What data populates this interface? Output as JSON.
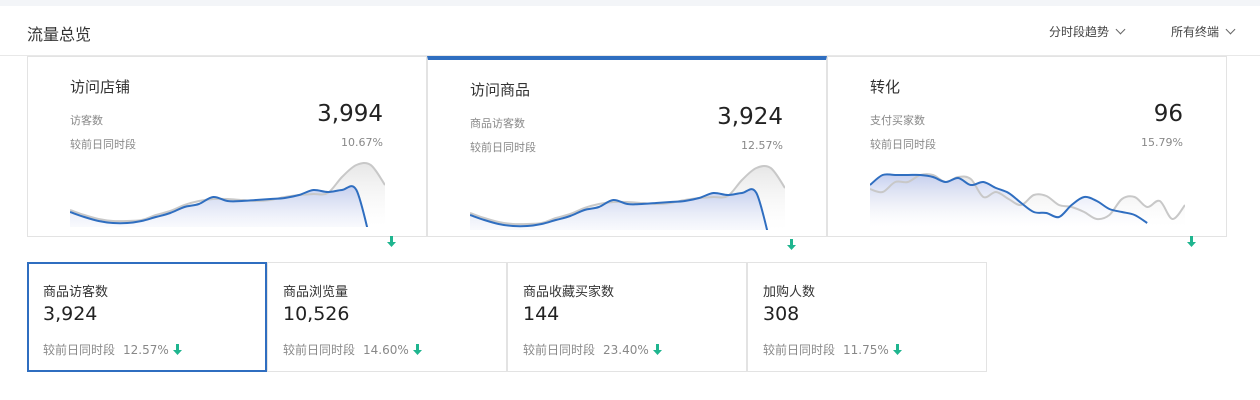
{
  "header": {
    "title": "流量总览",
    "time_dropdown": "分时段趋势",
    "terminal_dropdown": "所有终端"
  },
  "colors": {
    "accent": "#2f6ec0",
    "down_arrow": "#1fb58f",
    "today_line": "#2f6ec0",
    "yesterday_line": "#c8c8c8"
  },
  "big_cards": [
    {
      "title": "访问店铺",
      "metric": "访客数",
      "compare_label": "较前日同时段",
      "value": "3,994",
      "change": "10.67%",
      "trend": "down",
      "active": false,
      "chart": {
        "today": [
          55,
          60,
          64,
          66,
          66,
          64,
          60,
          56,
          50,
          47,
          40,
          44,
          44,
          43,
          42,
          41,
          38,
          33,
          35,
          33,
          33,
          85
        ],
        "yesterday": [
          53,
          58,
          62,
          64,
          64,
          63,
          58,
          54,
          48,
          44,
          42,
          42,
          43,
          44,
          43,
          40,
          38,
          37,
          36,
          20,
          8,
          8,
          28
        ]
      }
    },
    {
      "title": "访问商品",
      "metric": "商品访客数",
      "compare_label": "较前日同时段",
      "value": "3,924",
      "change": "12.57%",
      "trend": "down",
      "active": true,
      "chart": {
        "today": [
          55,
          60,
          64,
          66,
          66,
          64,
          60,
          56,
          50,
          47,
          40,
          44,
          44,
          43,
          42,
          41,
          38,
          33,
          35,
          33,
          33,
          85
        ],
        "yesterday": [
          53,
          58,
          62,
          64,
          64,
          63,
          58,
          54,
          48,
          44,
          42,
          42,
          43,
          44,
          43,
          40,
          38,
          37,
          36,
          20,
          8,
          8,
          28
        ]
      }
    },
    {
      "title": "转化",
      "metric": "支付买家数",
      "compare_label": "较前日同时段",
      "value": "96",
      "change": "15.79%",
      "trend": "down",
      "active": false,
      "chart": {
        "today": [
          28,
          18,
          18,
          18,
          18,
          20,
          25,
          21,
          28,
          25,
          31,
          36,
          46,
          55,
          56,
          60,
          48,
          40,
          44,
          52,
          55,
          58,
          66
        ],
        "yesterday": [
          32,
          35,
          25,
          25,
          18,
          18,
          25,
          20,
          22,
          40,
          35,
          42,
          48,
          38,
          39,
          48,
          50,
          55,
          62,
          58,
          42,
          40,
          50,
          44,
          62,
          48
        ]
      }
    }
  ],
  "small_cards": [
    {
      "label": "商品访客数",
      "value": "3,924",
      "compare_label": "较前日同时段",
      "change": "12.57%",
      "trend": "down",
      "selected": true
    },
    {
      "label": "商品浏览量",
      "value": "10,526",
      "compare_label": "较前日同时段",
      "change": "14.60%",
      "trend": "down",
      "selected": false
    },
    {
      "label": "商品收藏买家数",
      "value": "144",
      "compare_label": "较前日同时段",
      "change": "23.40%",
      "trend": "down",
      "selected": false
    },
    {
      "label": "加购人数",
      "value": "308",
      "compare_label": "较前日同时段",
      "change": "11.75%",
      "trend": "down",
      "selected": false
    }
  ]
}
